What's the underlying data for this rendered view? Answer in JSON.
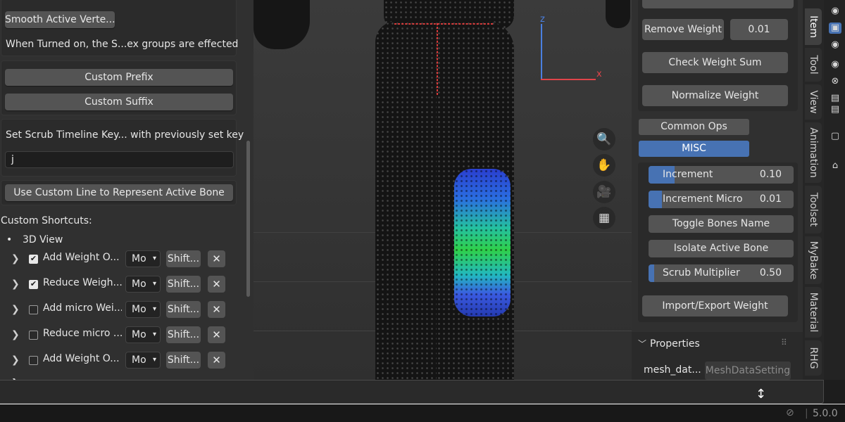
{
  "left_panel": {
    "smooth_button": "Smooth Active Verte...",
    "smooth_desc": "When Turned on, the S...ex groups are effected",
    "custom_prefix": "Custom Prefix",
    "custom_suffix": "Custom Suffix",
    "scrub_label": "Set Scrub Timeline Key... with previously set key",
    "scrub_value": "j",
    "custom_line_button": "Use Custom Line to Represent Active Bone",
    "shortcuts_title": "Custom Shortcuts:",
    "view_bullet": "3D View",
    "shortcuts": [
      {
        "name": "Add Weight O...",
        "checked": true,
        "mode": "Mo",
        "key": "Shift..."
      },
      {
        "name": "Reduce Weigh...",
        "checked": true,
        "mode": "Mo",
        "key": "Shift..."
      },
      {
        "name": "Add micro Wei...",
        "checked": false,
        "mode": "Mo",
        "key": "Shift..."
      },
      {
        "name": "Reduce micro ...",
        "checked": false,
        "mode": "Mo",
        "key": "Shift..."
      },
      {
        "name": "Add Weight O...",
        "checked": false,
        "mode": "Mo",
        "key": "Shift..."
      }
    ]
  },
  "sidebar": {
    "remove_weight": "Remove Weight",
    "remove_weight_value": "0.01",
    "check_weight_sum": "Check Weight Sum",
    "normalize_weight": "Normalize Weight",
    "tab_common": "Common Ops",
    "tab_misc": "MISC",
    "increment": {
      "label": "Increment",
      "value": "0.10",
      "fill": 0.18
    },
    "increment_micro": {
      "label": "Increment Micro",
      "value": "0.01",
      "fill": 0.09
    },
    "toggle_bones": "Toggle Bones Name",
    "isolate_bone": "Isolate Active Bone",
    "scrub_multiplier": {
      "label": "Scrub Multiplier",
      "value": "0.50",
      "fill": 0.04
    },
    "import_export": "Import/Export Weight",
    "properties_header": "Properties",
    "mesh_label": "mesh_dat...",
    "mesh_value": "MeshDataSetting"
  },
  "axes": {
    "z": "z",
    "x": "x"
  },
  "tabs": [
    "Item",
    "Tool",
    "View",
    "Animation",
    "Toolset",
    "MyBake",
    "Material",
    "RHG"
  ],
  "status": {
    "version": "5.0.0"
  },
  "colors": {
    "accent": "#4772b3",
    "seam": "#d83a3a",
    "axis_z": "#4a7fe0",
    "axis_x": "#e0444a"
  }
}
